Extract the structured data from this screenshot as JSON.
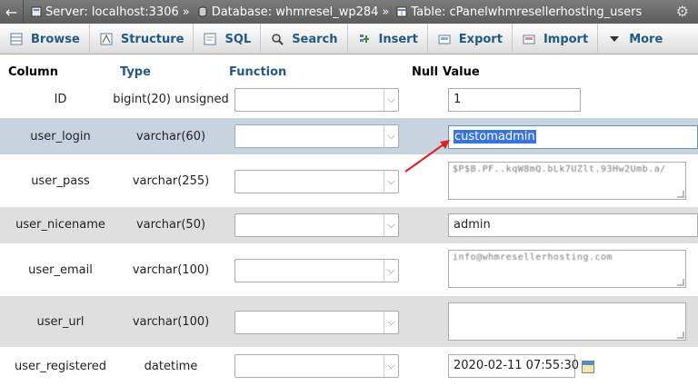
{
  "breadcrumb": {
    "server": "Server: localhost:3306",
    "database": "Database: whmresel_wp284",
    "table": "Table: cPanelwhmresellerhosting_users",
    "separator": "»"
  },
  "tabs": [
    {
      "label": "Browse",
      "icon": "browse-icon"
    },
    {
      "label": "Structure",
      "icon": "structure-icon"
    },
    {
      "label": "SQL",
      "icon": "sql-icon"
    },
    {
      "label": "Search",
      "icon": "search-icon"
    },
    {
      "label": "Insert",
      "icon": "insert-icon"
    },
    {
      "label": "Export",
      "icon": "export-icon"
    },
    {
      "label": "Import",
      "icon": "import-icon"
    },
    {
      "label": "More",
      "icon": "chevron-down-icon"
    }
  ],
  "headers": {
    "column": "Column",
    "type": "Type",
    "function": "Function",
    "null": "Null",
    "value": "Value"
  },
  "rows": [
    {
      "column": "ID",
      "type": "bigint(20) unsigned",
      "value": "1",
      "input": "text"
    },
    {
      "column": "user_login",
      "type": "varchar(60)",
      "value": "customadmin",
      "input": "text",
      "selected": true
    },
    {
      "column": "user_pass",
      "type": "varchar(255)",
      "value": "$P$B.PF..kqW8mQ.bLk7UZlt.93Hw2Umb.a/",
      "input": "textarea"
    },
    {
      "column": "user_nicename",
      "type": "varchar(50)",
      "value": "admin",
      "input": "text"
    },
    {
      "column": "user_email",
      "type": "varchar(100)",
      "value": "info@whmresellerhosting.com",
      "input": "textarea"
    },
    {
      "column": "user_url",
      "type": "varchar(100)",
      "value": "",
      "input": "textarea"
    },
    {
      "column": "user_registered",
      "type": "datetime",
      "value": "2020-02-11 07:55:30",
      "input": "text"
    }
  ],
  "colors": {
    "accent": "#235a81",
    "highlight_row": "#c8d3e0",
    "annotation_arrow": "#e02020"
  }
}
